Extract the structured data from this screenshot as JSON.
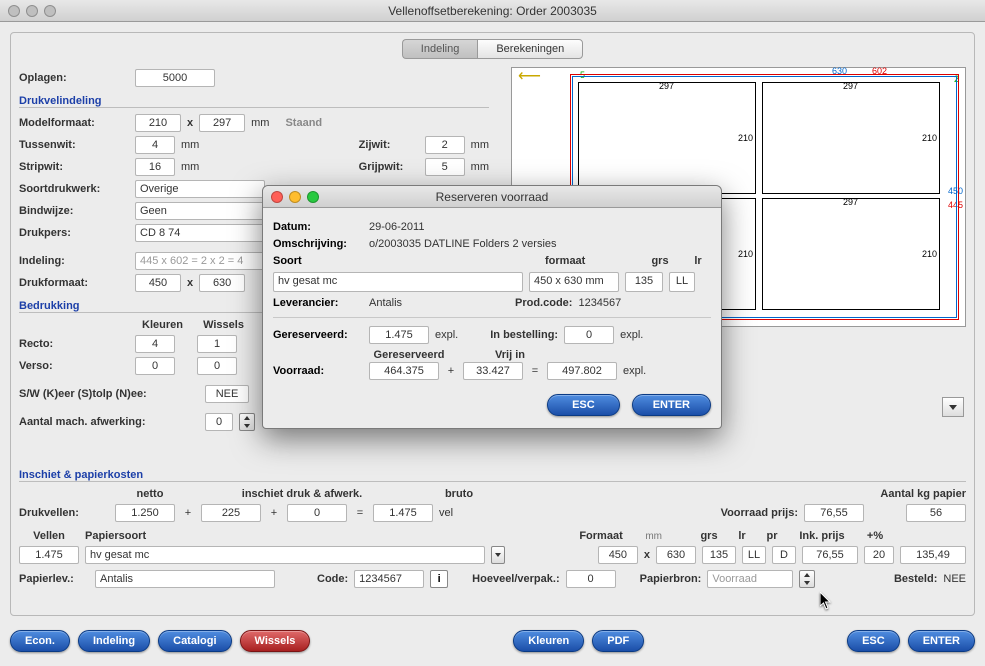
{
  "window": {
    "title": "Vellenoffsetberekening: Order 2003035"
  },
  "tabs": [
    "Indeling",
    "Berekeningen"
  ],
  "oplagen": {
    "label": "Oplagen:",
    "value": "5000"
  },
  "sections": {
    "drukvel": "Drukvelindeling",
    "bedrukking": "Bedrukking",
    "inschiet": "Inschiet & papierkosten"
  },
  "form": {
    "modelformaat": {
      "label": "Modelformaat:",
      "w": "210",
      "h": "297",
      "unit": "mm",
      "orient": "Staand"
    },
    "tussenwit": {
      "label": "Tussenwit:",
      "v": "4",
      "unit": "mm"
    },
    "zijwit": {
      "label": "Zijwit:",
      "v": "2",
      "unit": "mm"
    },
    "stripwit": {
      "label": "Stripwit:",
      "v": "16",
      "unit": "mm"
    },
    "grijpwit": {
      "label": "Grijpwit:",
      "v": "5",
      "unit": "mm"
    },
    "soort": {
      "label": "Soortdrukwerk:",
      "v": "Overige"
    },
    "bindwijze": {
      "label": "Bindwijze:",
      "v": "Geen"
    },
    "drukpers": {
      "label": "Drukpers:",
      "v": "CD 8 74"
    },
    "indeling": {
      "label": "Indeling:",
      "v": "445 x 602 = 2 x 2 = 4"
    },
    "drukformaat": {
      "label": "Drukformaat:",
      "w": "450",
      "h": "630"
    }
  },
  "bedrukking": {
    "kleuren": "Kleuren",
    "wissels": "Wissels",
    "recto": {
      "label": "Recto:",
      "k": "4",
      "w": "1"
    },
    "verso": {
      "label": "Verso:",
      "k": "0",
      "w": "0"
    },
    "sw": {
      "label": "S/W (K)eer (S)tolp (N)ee:",
      "v": "NEE"
    },
    "afw": {
      "label": "Aantal mach. afwerking:",
      "v": "0"
    }
  },
  "inschiet": {
    "netto": "netto",
    "mid": "inschiet druk & afwerk.",
    "bruto": "bruto",
    "drukvellen": {
      "label": "Drukvellen:",
      "a": "1.250",
      "b": "225",
      "c": "0",
      "d": "1.475",
      "unit": "vel"
    },
    "voorraadprijs": {
      "label": "Voorraad prijs:",
      "v": "76,55"
    },
    "aantalkg": {
      "label": "Aantal kg papier",
      "v": "56"
    },
    "vellen": {
      "label": "Vellen",
      "v": "1.475"
    },
    "papiersoort": {
      "label": "Papiersoort",
      "v": "hv gesat mc"
    },
    "formaat": {
      "label": "Formaat",
      "unit": "mm",
      "w": "450",
      "h": "630"
    },
    "grs": {
      "label": "grs",
      "v": "135"
    },
    "lr": {
      "label": "lr",
      "v": "LL"
    },
    "pr": {
      "label": "pr",
      "v": "D"
    },
    "inkprijs": {
      "label": "Ink. prijs",
      "v": "76,55"
    },
    "pluspct": {
      "label": "+%",
      "v": "20"
    },
    "total": "135,49",
    "papierlev": {
      "label": "Papierlev.:",
      "v": "Antalis"
    },
    "code": {
      "label": "Code:",
      "v": "1234567"
    },
    "hoeveel": {
      "label": "Hoeveel/verpak.:",
      "v": "0"
    },
    "papierbron": {
      "label": "Papierbron:",
      "v": "Voorraad"
    },
    "besteld": {
      "label": "Besteld:",
      "v": "NEE"
    }
  },
  "toolbar": {
    "econ": "Econ.",
    "indeling": "Indeling",
    "catalogi": "Catalogi",
    "wissels": "Wissels",
    "kleuren": "Kleuren",
    "pdf": "PDF",
    "esc": "ESC",
    "enter": "ENTER"
  },
  "modal": {
    "title": "Reserveren voorraad",
    "datum": {
      "label": "Datum:",
      "v": "29-06-2011"
    },
    "omschr": {
      "label": "Omschrijving:",
      "v": "o/2003035 DATLINE Folders 2 versies"
    },
    "soort": {
      "label": "Soort",
      "v": "hv gesat mc"
    },
    "formaat": {
      "label": "formaat",
      "v": "450 x 630 mm"
    },
    "grs": {
      "label": "grs",
      "v": "135"
    },
    "lr": {
      "label": "lr",
      "v": "LL"
    },
    "leverancier": {
      "label": "Leverancier:",
      "v": "Antalis"
    },
    "prodcode": {
      "label": "Prod.code:",
      "v": "1234567"
    },
    "geres": {
      "label": "Gereserveerd:",
      "v": "1.475",
      "unit": "expl."
    },
    "inbest": {
      "label": "In bestelling:",
      "v": "0",
      "unit": "expl."
    },
    "voorraad": {
      "label": "Voorraad:",
      "a": "464.375",
      "b": "33.427",
      "c": "497.802",
      "unit": "expl.",
      "hdr_a": "Gereserveerd",
      "hdr_b": "Vrij in"
    },
    "esc": "ESC",
    "enter": "ENTER"
  },
  "diagram": {
    "w": "630",
    "red": "602",
    "p1": "297",
    "p2": "210",
    "blue": "450",
    "redr": "445",
    "g2": "2",
    "g5": "5"
  }
}
